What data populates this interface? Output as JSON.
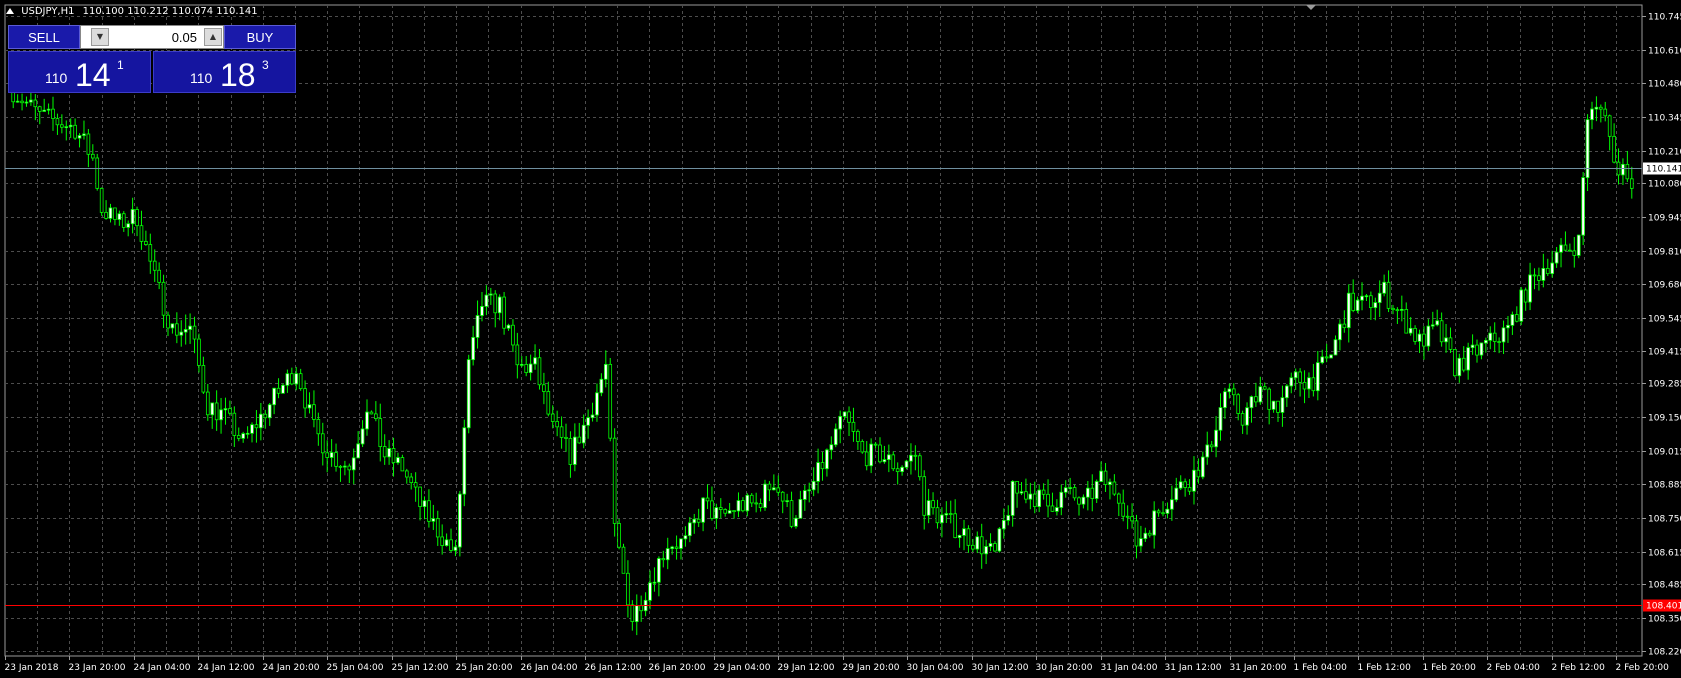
{
  "chart": {
    "symbol_label": "USDJPY,H1",
    "ohlc_label": "110.100 110.212 110.074 110.141",
    "current_price_label": "110.141",
    "line_price_label": "108.401",
    "current_price": 110.141,
    "line_price": 108.401
  },
  "trade_panel": {
    "sell_label": "SELL",
    "buy_label": "BUY",
    "lot_value": "0.05",
    "sell_price": {
      "big": "110",
      "main": "14",
      "sup": "1"
    },
    "buy_price": {
      "big": "110",
      "main": "18",
      "sup": "3"
    }
  },
  "colors": {
    "background": "#000000",
    "grid": "#4d4d4d",
    "up_candle": "#ffffff",
    "down_candle": "#000000",
    "candle_wick": "#00ff00",
    "bid_line": "#6f8f9f",
    "level_line": "#ff0000",
    "panel_blue": "#1a1aaa"
  },
  "chart_data": {
    "type": "candlestick",
    "y_ticks": [
      "110.745",
      "110.610",
      "110.480",
      "110.345",
      "110.210",
      "110.080",
      "109.945",
      "109.810",
      "109.680",
      "109.545",
      "109.415",
      "109.285",
      "109.150",
      "109.015",
      "108.885",
      "108.750",
      "108.615",
      "108.485",
      "108.350",
      "108.220"
    ],
    "x_ticks": [
      "23 Jan 2018",
      "23 Jan 20:00",
      "24 Jan 04:00",
      "24 Jan 12:00",
      "24 Jan 20:00",
      "25 Jan 04:00",
      "25 Jan 12:00",
      "25 Jan 20:00",
      "26 Jan 04:00",
      "26 Jan 12:00",
      "26 Jan 20:00",
      "29 Jan 04:00",
      "29 Jan 12:00",
      "29 Jan 20:00",
      "30 Jan 04:00",
      "30 Jan 12:00",
      "30 Jan 20:00",
      "31 Jan 04:00",
      "31 Jan 12:00",
      "31 Jan 20:00",
      "1 Feb 04:00",
      "1 Feb 12:00",
      "1 Feb 20:00",
      "2 Feb 04:00",
      "2 Feb 12:00",
      "2 Feb 20:00"
    ],
    "ylim": [
      108.2,
      110.79
    ],
    "anchors": [
      [
        0,
        110.45
      ],
      [
        6,
        110.35
      ],
      [
        14,
        110.3
      ],
      [
        18,
        110.18
      ],
      [
        20,
        109.98
      ],
      [
        24,
        109.92
      ],
      [
        28,
        109.95
      ],
      [
        32,
        109.7
      ],
      [
        36,
        109.5
      ],
      [
        40,
        109.5
      ],
      [
        44,
        109.2
      ],
      [
        48,
        109.15
      ],
      [
        52,
        109.05
      ],
      [
        56,
        109.15
      ],
      [
        60,
        109.25
      ],
      [
        64,
        109.35
      ],
      [
        68,
        109.1
      ],
      [
        72,
        109.0
      ],
      [
        76,
        108.95
      ],
      [
        80,
        109.2
      ],
      [
        84,
        109.0
      ],
      [
        88,
        108.95
      ],
      [
        92,
        108.8
      ],
      [
        96,
        108.7
      ],
      [
        100,
        108.6
      ],
      [
        103,
        109.35
      ],
      [
        106,
        109.6
      ],
      [
        110,
        109.6
      ],
      [
        114,
        109.35
      ],
      [
        118,
        109.35
      ],
      [
        122,
        109.1
      ],
      [
        126,
        109.0
      ],
      [
        130,
        109.15
      ],
      [
        134,
        109.35
      ],
      [
        136,
        108.7
      ],
      [
        140,
        108.35
      ],
      [
        144,
        108.5
      ],
      [
        148,
        108.65
      ],
      [
        152,
        108.65
      ],
      [
        156,
        108.8
      ],
      [
        160,
        108.75
      ],
      [
        164,
        108.8
      ],
      [
        168,
        108.8
      ],
      [
        172,
        108.9
      ],
      [
        176,
        108.75
      ],
      [
        180,
        108.85
      ],
      [
        184,
        109.0
      ],
      [
        188,
        109.15
      ],
      [
        192,
        109.0
      ],
      [
        196,
        109.0
      ],
      [
        200,
        108.95
      ],
      [
        204,
        109.0
      ],
      [
        206,
        108.8
      ],
      [
        210,
        108.75
      ],
      [
        214,
        108.7
      ],
      [
        218,
        108.65
      ],
      [
        222,
        108.6
      ],
      [
        226,
        108.85
      ],
      [
        230,
        108.85
      ],
      [
        234,
        108.8
      ],
      [
        238,
        108.85
      ],
      [
        242,
        108.8
      ],
      [
        246,
        108.9
      ],
      [
        250,
        108.85
      ],
      [
        254,
        108.65
      ],
      [
        258,
        108.75
      ],
      [
        262,
        108.85
      ],
      [
        266,
        108.9
      ],
      [
        270,
        109.0
      ],
      [
        274,
        109.25
      ],
      [
        278,
        109.15
      ],
      [
        282,
        109.25
      ],
      [
        286,
        109.2
      ],
      [
        290,
        109.3
      ],
      [
        294,
        109.3
      ],
      [
        298,
        109.4
      ],
      [
        302,
        109.6
      ],
      [
        306,
        109.6
      ],
      [
        310,
        109.65
      ],
      [
        314,
        109.55
      ],
      [
        318,
        109.45
      ],
      [
        322,
        109.5
      ],
      [
        326,
        109.35
      ],
      [
        330,
        109.4
      ],
      [
        334,
        109.45
      ],
      [
        338,
        109.5
      ],
      [
        342,
        109.65
      ],
      [
        346,
        109.75
      ],
      [
        350,
        109.8
      ],
      [
        354,
        109.85
      ],
      [
        356,
        110.35
      ],
      [
        360,
        110.38
      ],
      [
        362,
        110.15
      ],
      [
        364,
        110.15
      ],
      [
        366,
        110.1
      ]
    ]
  }
}
